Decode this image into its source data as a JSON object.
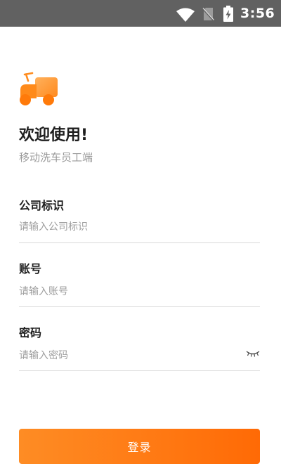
{
  "status_bar": {
    "time": "3:56",
    "icons": [
      "wifi-icon",
      "no-sim-icon",
      "battery-charging-icon"
    ]
  },
  "app": {
    "logo_icon": "truck-icon",
    "title": "欢迎使用!",
    "subtitle": "移动洗车员工端"
  },
  "form": {
    "company": {
      "label": "公司标识",
      "placeholder": "请输入公司标识",
      "value": ""
    },
    "account": {
      "label": "账号",
      "placeholder": "请输入账号",
      "value": ""
    },
    "password": {
      "label": "密码",
      "placeholder": "请输入密码",
      "value": "",
      "toggle_icon": "eye-closed-icon"
    }
  },
  "login_button": {
    "label": "登录"
  },
  "colors": {
    "accent": "#ff7a14",
    "accent_light": "#fe8c24",
    "status_bar": "#616161",
    "text_primary": "#1e1e1e",
    "text_secondary": "#9a9a9a",
    "divider": "#d9d9d9"
  }
}
